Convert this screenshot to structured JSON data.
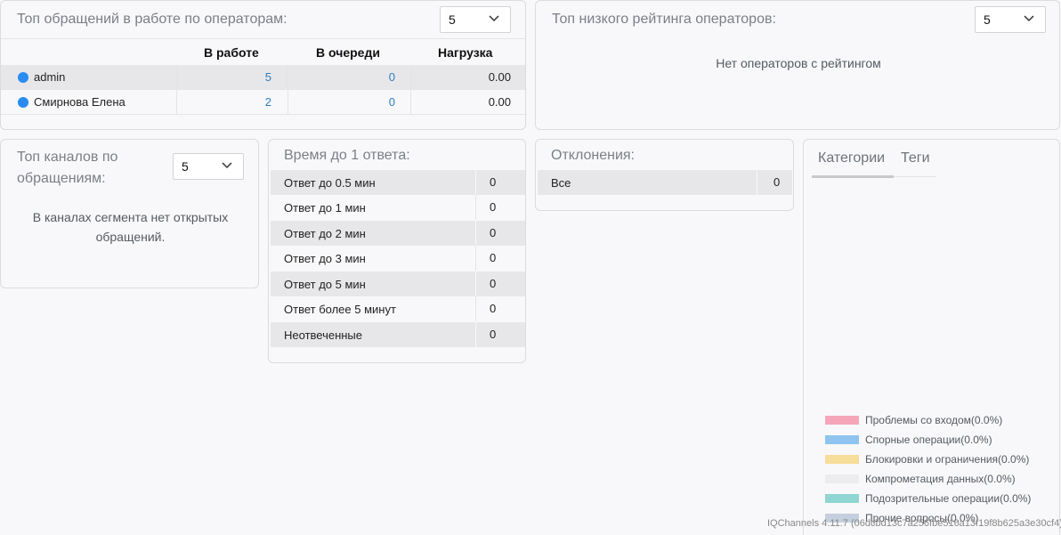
{
  "operators_panel": {
    "title": "Топ обращений в работе по операторам:",
    "limit": "5",
    "columns": [
      "В работе",
      "В очереди",
      "Нагрузка"
    ],
    "rows": [
      {
        "name": "admin",
        "in_work": "5",
        "in_queue": "0",
        "load": "0.00"
      },
      {
        "name": "Смирнова Елена",
        "in_work": "2",
        "in_queue": "0",
        "load": "0.00"
      }
    ]
  },
  "low_rating_panel": {
    "title": "Топ низкого рейтинга операторов:",
    "limit": "5",
    "empty_text": "Нет операторов с рейтингом"
  },
  "channels_panel": {
    "title_line1": "Топ каналов по",
    "title_line2": "обращениям:",
    "limit": "5",
    "empty_line1": "В каналах сегмента нет открытых",
    "empty_line2": "обращений."
  },
  "first_response_panel": {
    "title": "Время до 1 ответа:",
    "rows": [
      {
        "label": "Ответ до 0.5 мин",
        "value": "0"
      },
      {
        "label": "Ответ до 1 мин",
        "value": "0"
      },
      {
        "label": "Ответ до 2 мин",
        "value": "0"
      },
      {
        "label": "Ответ до 3 мин",
        "value": "0"
      },
      {
        "label": "Ответ до 5 мин",
        "value": "0"
      },
      {
        "label": "Ответ более 5 минут",
        "value": "0"
      },
      {
        "label": "Неотвеченные",
        "value": "0"
      }
    ]
  },
  "deviations_panel": {
    "title": "Отклонения:",
    "rows": [
      {
        "label": "Все",
        "value": "0"
      }
    ]
  },
  "categories_panel": {
    "tabs": [
      "Категории",
      "Теги"
    ],
    "active_tab": "Категории",
    "legend": [
      {
        "label": "Проблемы со входом(0.0%)",
        "color": "#f4a6b8"
      },
      {
        "label": "Спорные операции(0.0%)",
        "color": "#8ec4ef"
      },
      {
        "label": "Блокировки и ограничения(0.0%)",
        "color": "#f7dd9a"
      },
      {
        "label": "Компрометация данных(0.0%)",
        "color": "#ececee"
      },
      {
        "label": "Подозрительные операции(0.0%)",
        "color": "#8fd5d2"
      },
      {
        "label": "Прочие вопросы(0.0%)",
        "color": "#c4d0dd"
      }
    ]
  },
  "footer": {
    "version": "IQChannels 4.11.7 (06dcbd13c7a256fbe516a13f19f8b625a3e30cf4)"
  }
}
